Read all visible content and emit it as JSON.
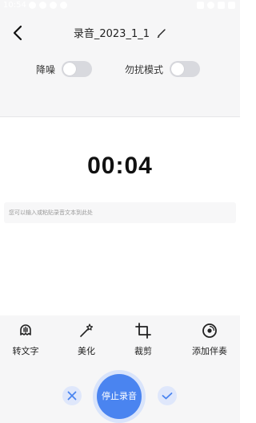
{
  "status_bar": {
    "time": "10:54"
  },
  "header": {
    "title": "录音_2023_1_1"
  },
  "toggles": {
    "noise_reduction": {
      "label": "降噪",
      "on": false
    },
    "do_not_disturb": {
      "label": "勿扰模式",
      "on": false
    }
  },
  "recorder": {
    "elapsed": "00:04",
    "text_placeholder": "您可以输入或粘贴录音文本到此处"
  },
  "tools": [
    {
      "label": "转文字",
      "icon": "speech-to-text-icon"
    },
    {
      "label": "美化",
      "icon": "magic-wand-icon"
    },
    {
      "label": "裁剪",
      "icon": "crop-icon"
    },
    {
      "label": "添加伴奏",
      "icon": "music-disc-icon"
    }
  ],
  "actions": {
    "stop_label": "停止录音",
    "cancel_icon": "close-icon",
    "confirm_icon": "check-icon"
  },
  "colors": {
    "accent": "#4a84f0",
    "accent_light": "#dfe7fb",
    "panel_bg": "#f6f6f7",
    "switch_off": "#d8d9de"
  }
}
